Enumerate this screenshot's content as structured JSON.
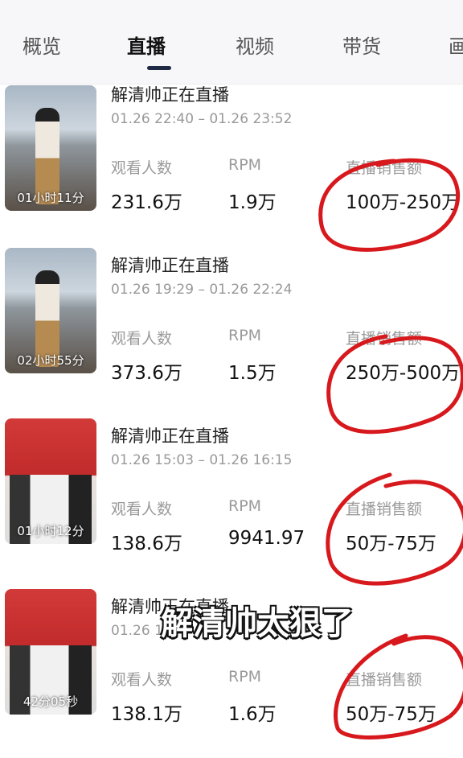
{
  "tabs": [
    "概览",
    "直播",
    "视频",
    "带货",
    "画"
  ],
  "active_tab": "直播",
  "sessions": [
    {
      "title": "解清帅正在直播",
      "time": "01.26 22:40 – 01.26 23:52",
      "duration": "01小时11分",
      "viewers_label": "观看人数",
      "viewers": "231.6万",
      "rpm_label": "RPM",
      "rpm": "1.9万",
      "sales_label": "直播销售额",
      "sales": "100万-250万"
    },
    {
      "title": "解清帅正在直播",
      "time": "01.26 19:29 – 01.26 22:24",
      "duration": "02小时55分",
      "viewers_label": "观看人数",
      "viewers": "373.6万",
      "rpm_label": "RPM",
      "rpm": "1.5万",
      "sales_label": "直播销售额",
      "sales": "250万-500万"
    },
    {
      "title": "解清帅正在直播",
      "time": "01.26 15:03 – 01.26 16:15",
      "duration": "01小时12分",
      "viewers_label": "观看人数",
      "viewers": "138.6万",
      "rpm_label": "RPM",
      "rpm": "9941.97",
      "sales_label": "直播销售额",
      "sales": "50万-75万"
    },
    {
      "title": "解清帅正在直播",
      "time": "01.26 1",
      "duration": "42分05秒",
      "viewers_label": "观看人数",
      "viewers": "138.1万",
      "rpm_label": "RPM",
      "rpm": "1.6万",
      "sales_label": "直播销售额",
      "sales": "50万-75万"
    }
  ],
  "caption": "解清帅太狠了",
  "colors": {
    "circle": "#d7191d",
    "tab_indicator": "#1f2a44"
  }
}
